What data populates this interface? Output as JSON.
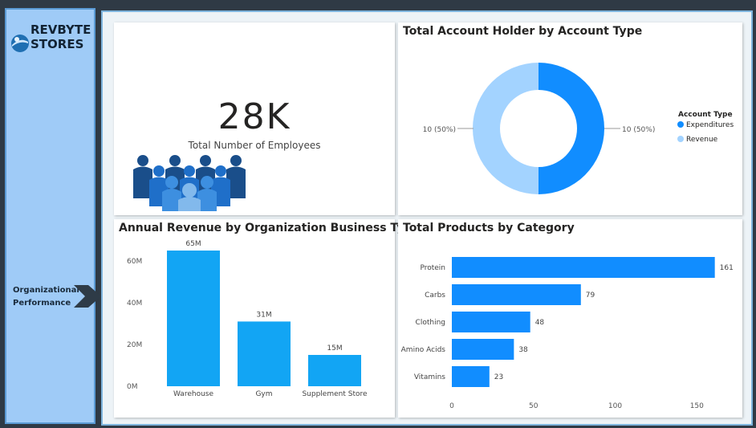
{
  "sidebar": {
    "brand_line1": "REVBYTE",
    "brand_line2": "STORES",
    "nav_label": "Organizational Performance"
  },
  "kpi": {
    "value": "28K",
    "label": "Total Number of Employees"
  },
  "colors": {
    "primary": "#118dff",
    "light": "#a3d3ff",
    "bar": "#12a5f4",
    "sidebar": "#9fcbf7"
  },
  "donut": {
    "title": "Total Account Holder by Account Type",
    "legend_title": "Account Type",
    "left_label": "10 (50%)",
    "right_label": "10 (50%)",
    "chart_data": {
      "type": "pie",
      "categories": [
        "Expenditures",
        "Revenue"
      ],
      "values": [
        10,
        10
      ]
    }
  },
  "revenue": {
    "title": "Annual Revenue by Organization Business Type",
    "ticks": [
      "0M",
      "20M",
      "40M",
      "60M"
    ],
    "chart_data": {
      "type": "bar",
      "categories": [
        "Warehouse",
        "Gym",
        "Supplement Store"
      ],
      "values": [
        65,
        31,
        15
      ],
      "labels": [
        "65M",
        "31M",
        "15M"
      ],
      "ylim": [
        0,
        70
      ]
    }
  },
  "products": {
    "title": "Total Products by Category",
    "ticks": [
      "0",
      "50",
      "100",
      "150"
    ],
    "chart_data": {
      "type": "bar",
      "orientation": "horizontal",
      "categories": [
        "Protein",
        "Carbs",
        "Clothing",
        "Amino Acids",
        "Vitamins"
      ],
      "values": [
        161,
        79,
        48,
        38,
        23
      ],
      "xlim": [
        0,
        170
      ]
    }
  }
}
